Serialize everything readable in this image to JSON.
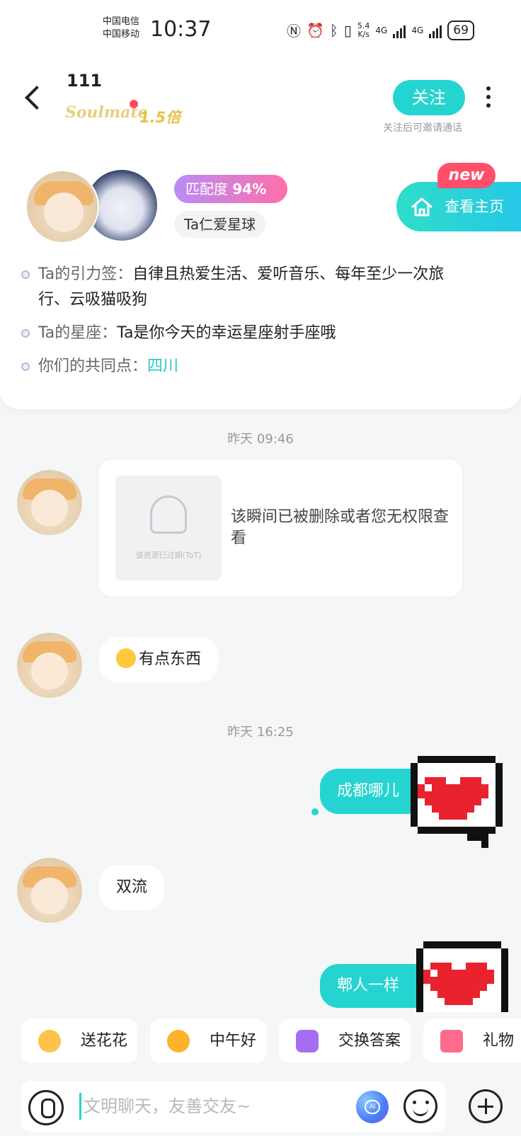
{
  "status_bar": {
    "carrier_1": "中国电信",
    "carrier_2": "中国移动",
    "time": "10:37",
    "net_speed_value": "5.4",
    "net_speed_unit": "K/s",
    "net_1": "4G",
    "net_2": "4G",
    "battery": "69"
  },
  "header": {
    "title": "111",
    "badge_text": "Soulmate",
    "badge_multiplier": "1.5倍",
    "follow_label": "关注",
    "follow_hint": "关注后可邀请通话"
  },
  "profile": {
    "match_label": "匹配度",
    "match_value": "94%",
    "planet_tag": "Ta仁爱星球",
    "homepage_label": "查看主页",
    "new_badge": "new",
    "info": [
      {
        "label": "Ta的引力签：",
        "value": "自律且热爱生活、爱听音乐、每年至少一次旅",
        "value_cont": "行、云吸猫吸狗"
      },
      {
        "label": "Ta的星座：",
        "value": "Ta是你今天的幸运星座射手座哦"
      },
      {
        "label": "你们的共同点：",
        "value": "四川"
      }
    ]
  },
  "chat": {
    "timestamp_1": "昨天 09:46",
    "moment_expired_text": "该资源已过期(ToT)",
    "moment_message": "该瞬间已被删除或者您无权限查看",
    "msg_1": "有点东西",
    "timestamp_2": "昨天 16:25",
    "msg_2": "成都哪儿",
    "msg_3": "双流",
    "msg_4": "郫人一样"
  },
  "quick_replies": [
    {
      "label": "送花花",
      "icon": "flower-emoji-icon"
    },
    {
      "label": "中午好",
      "icon": "sun-sunglasses-emoji-icon"
    },
    {
      "label": "交换答案",
      "icon": "exchange-icon"
    },
    {
      "label": "礼物",
      "icon": "gift-icon"
    }
  ],
  "input": {
    "placeholder": "文明聊天，友善交友~"
  },
  "colors": {
    "accent": "#25d4d0",
    "match_gradient_start": "#b98cf6",
    "match_gradient_end": "#ff6fa8",
    "new_badge": "#ff4f6b"
  }
}
